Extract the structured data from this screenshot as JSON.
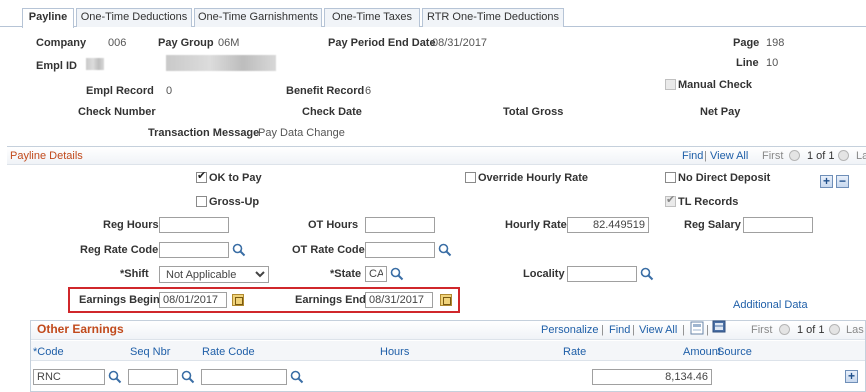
{
  "tabs": [
    {
      "label": "Payline",
      "active": true
    },
    {
      "label": "One-Time Deductions",
      "active": false
    },
    {
      "label": "One-Time Garnishments",
      "active": false
    },
    {
      "label": "One-Time Taxes",
      "active": false
    },
    {
      "label": "RTR One-Time Deductions",
      "active": false
    }
  ],
  "header": {
    "company_label": "Company",
    "company_value": "006",
    "pay_group_label": "Pay Group",
    "pay_group_value": "06M",
    "period_end_label": "Pay Period End Date",
    "period_end_value": "08/31/2017",
    "page_label": "Page",
    "page_value": "198",
    "empl_id_label": "Empl ID",
    "line_label": "Line",
    "line_value": "10",
    "empl_record_label": "Empl Record",
    "empl_record_value": "0",
    "benefit_record_label": "Benefit Record",
    "benefit_record_value": "6",
    "manual_check_label": "Manual Check",
    "check_number_label": "Check Number",
    "check_date_label": "Check Date",
    "total_gross_label": "Total Gross",
    "net_pay_label": "Net Pay",
    "transaction_message_label": "Transaction Message",
    "transaction_message_value": "Pay Data Change"
  },
  "payline": {
    "title": "Payline Details",
    "nav_find": "Find",
    "nav_sep": "|",
    "nav_view_all": "View All",
    "nav_first": "First",
    "nav_count": "1 of 1",
    "nav_last": "La",
    "ok_to_pay_label": "OK to Pay",
    "override_hourly_label": "Override Hourly Rate",
    "no_direct_deposit_label": "No Direct Deposit",
    "gross_up_label": "Gross-Up",
    "tl_records_label": "TL Records",
    "reg_hours_label": "Reg Hours",
    "ot_hours_label": "OT Hours",
    "hourly_rate_label": "Hourly Rate",
    "hourly_rate_value": "82.449519",
    "reg_salary_label": "Reg Salary",
    "reg_rate_code_label": "Reg Rate Code",
    "ot_rate_code_label": "OT Rate Code",
    "shift_label": "*Shift",
    "shift_value": "Not Applicable",
    "state_label": "*State",
    "state_value": "CA",
    "locality_label": "Locality",
    "earnings_begin_label": "Earnings Begin",
    "earnings_begin_value": "08/01/2017",
    "earnings_end_label": "Earnings End",
    "earnings_end_value": "08/31/2017",
    "additional_data": "Additional Data"
  },
  "other_earnings": {
    "title": "Other Earnings",
    "personalize": "Personalize",
    "find": "Find",
    "view_all": "View All",
    "first": "First",
    "count": "1 of 1",
    "last": "Las",
    "columns": {
      "code": "*Code",
      "seq_nbr": "Seq Nbr",
      "rate_code": "Rate Code",
      "hours": "Hours",
      "rate": "Rate",
      "amount": "Amount",
      "source": "Source"
    },
    "row": {
      "code": "RNC",
      "seq_nbr": "",
      "rate_code": "",
      "hours": "",
      "rate": "",
      "amount": "8,134.46",
      "source": ""
    }
  },
  "colors": {
    "link": "#1f5fa8",
    "section_title": "#c14a1c",
    "highlight_box": "#d0272b"
  }
}
